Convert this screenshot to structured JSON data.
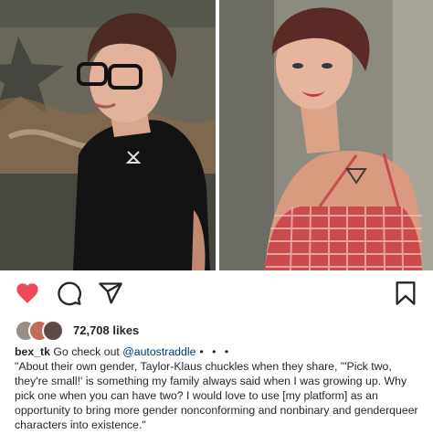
{
  "post": {
    "image_left_alt": "Photo: person with glasses in black shirt in front of graffiti wall",
    "image_right_alt": "Photo: person in red gingham top looking over shoulder"
  },
  "actions": {
    "like_icon": "heart-icon-filled",
    "comment_icon": "comment-icon",
    "share_icon": "send-icon",
    "save_icon": "bookmark-icon",
    "like_color": "#ed4956"
  },
  "likes": {
    "count_text": "72,708 likes"
  },
  "caption": {
    "username": "bex_tk",
    "intro": " Go check out ",
    "mention": "@autostraddle",
    "more": "• • •",
    "text": "\"About their own gender, Taylor-Klaus chuckles when they share, \"'Pick two, they're small!' is something my family always said when I was growing up. Why pick one when you can have two? I would love to use [my platform] as an opportunity to bring more gender nonconforming and nonbinary and genderqueer characters into existence.\""
  }
}
